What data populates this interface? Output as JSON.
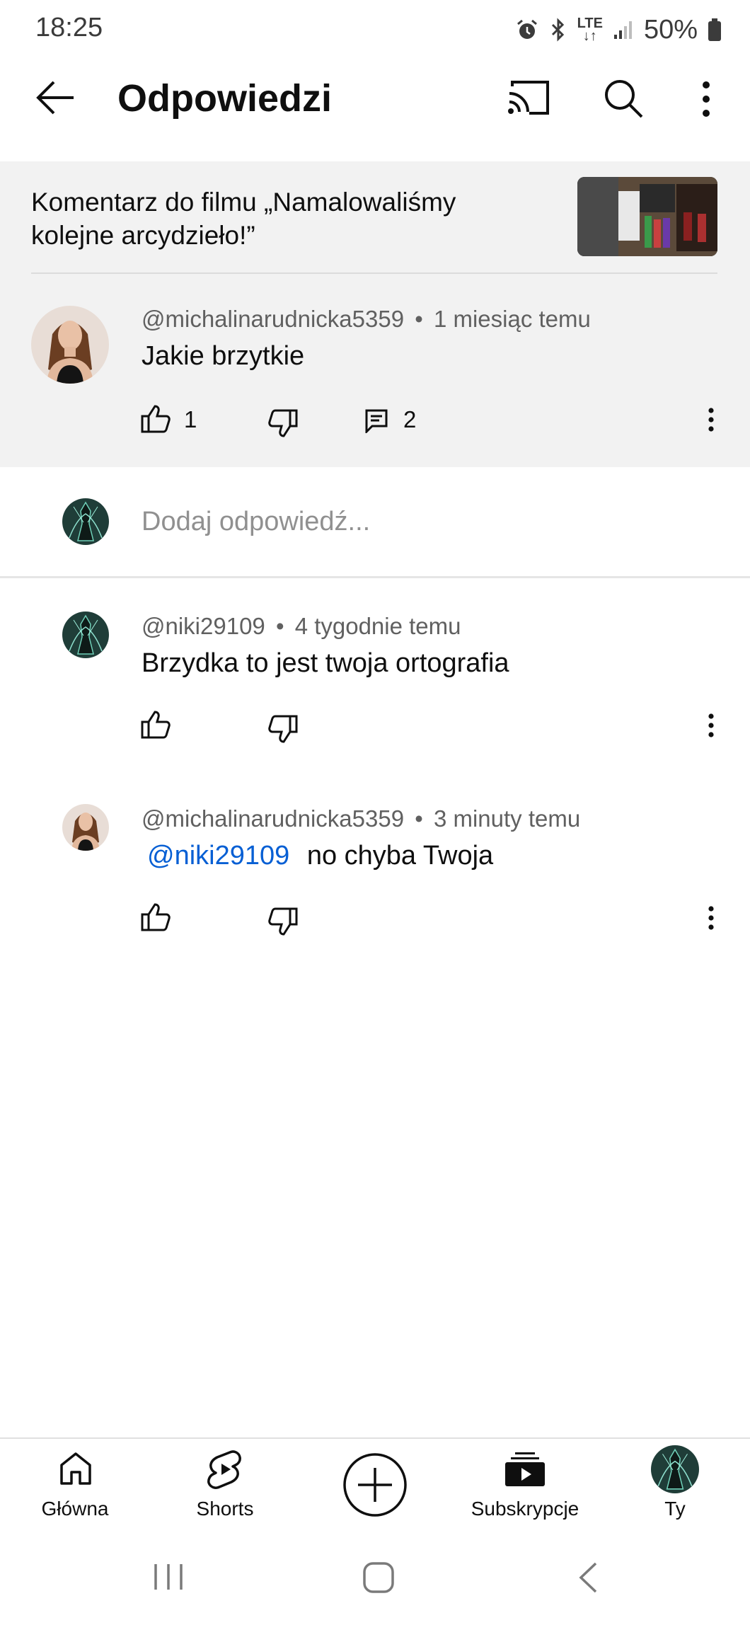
{
  "status_bar": {
    "time": "18:25",
    "network": "LTE",
    "battery": "50%",
    "icons": [
      "alarm-icon",
      "bluetooth-icon",
      "lte-icon",
      "signal-icon",
      "battery-icon"
    ]
  },
  "header": {
    "title": "Odpowiedzi",
    "icons": [
      "back-arrow-icon",
      "cast-icon",
      "search-icon",
      "more-vert-icon"
    ]
  },
  "context": {
    "text": "Komentarz do filmu „Namalowaliśmy kolejne arcydzieło!”"
  },
  "main_comment": {
    "author": "@michalinarudnicka5359",
    "time": "1 miesiąc temu",
    "text": "Jakie brzytkie",
    "likes": "1",
    "replies": "2"
  },
  "reply_input": {
    "placeholder": "Dodaj odpowiedź..."
  },
  "replies": [
    {
      "author": "@niki29109",
      "time": "4 tygodnie temu",
      "text": "Brzydka to jest twoja ortografia"
    },
    {
      "author": "@michalinarudnicka5359",
      "time": "3 minuty temu",
      "mention": "@niki29109",
      "text": "no chyba Twoja"
    }
  ],
  "separator": "•",
  "bottom_nav": {
    "items": [
      {
        "label": "Główna",
        "icon": "home-icon"
      },
      {
        "label": "Shorts",
        "icon": "shorts-icon"
      },
      {
        "label": "",
        "icon": "create-icon"
      },
      {
        "label": "Subskrypcje",
        "icon": "subscriptions-icon"
      },
      {
        "label": "Ty",
        "icon": "avatar"
      }
    ]
  },
  "colors": {
    "mention": "#065fd4",
    "panel_bg": "#f2f2f2",
    "meta_text": "#606060"
  }
}
